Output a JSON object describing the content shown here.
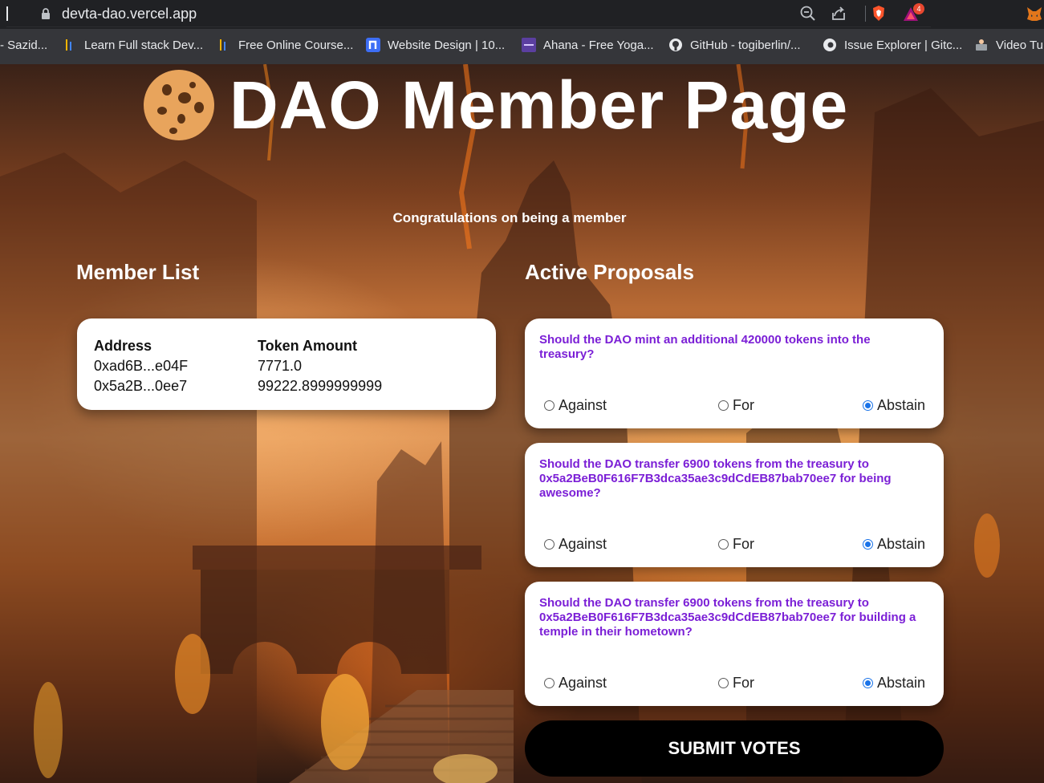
{
  "browser": {
    "url": "devta-dao.vercel.app",
    "bookmarks": [
      {
        "label": "- Sazid..."
      },
      {
        "label": "Learn Full stack Dev..."
      },
      {
        "label": "Free Online Course..."
      },
      {
        "label": "Website Design | 10..."
      },
      {
        "label": "Ahana - Free Yoga..."
      },
      {
        "label": "GitHub - togiberlin/..."
      },
      {
        "label": "Issue Explorer | Gitc..."
      },
      {
        "label": "Video Tu"
      }
    ],
    "notification_count": "4",
    "colors": {
      "chrome": "#202124",
      "bookmarks_bar": "#35363a"
    }
  },
  "page": {
    "title": "DAO Member Page",
    "subtitle": "Congratulations on being a member",
    "member_list": {
      "heading": "Member List",
      "columns": [
        "Address",
        "Token Amount"
      ],
      "rows": [
        [
          "0xad6B...e04F",
          "7771.0"
        ],
        [
          "0x5a2B...0ee7",
          "99222.8999999999"
        ]
      ]
    },
    "proposals": {
      "heading": "Active Proposals",
      "items": [
        {
          "question": "Should the DAO mint an additional 420000 tokens into the treasury?",
          "options": [
            "Against",
            "For",
            "Abstain"
          ],
          "selected": "Abstain"
        },
        {
          "question": "Should the DAO transfer 6900 tokens from the treasury to 0x5a2BeB0F616F7B3dca35ae3c9dCdEB87bab70ee7 for being awesome?",
          "options": [
            "Against",
            "For",
            "Abstain"
          ],
          "selected": "Abstain"
        },
        {
          "question": "Should the DAO transfer 6900 tokens from the treasury to 0x5a2BeB0F616F7B3dca35ae3c9dCdEB87bab70ee7 for building a temple in their hometown?",
          "options": [
            "Against",
            "For",
            "Abstain"
          ],
          "selected": "Abstain"
        }
      ]
    },
    "submit_label": "SUBMIT VOTES",
    "colors": {
      "question": "#7b1fd6",
      "radio_accent": "#1a73e8"
    }
  }
}
